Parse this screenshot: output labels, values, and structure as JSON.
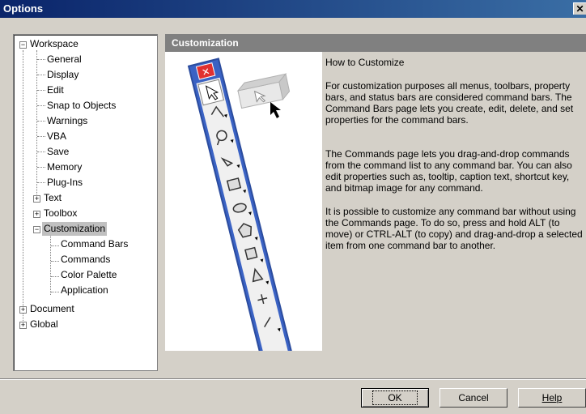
{
  "window": {
    "title": "Options",
    "close_glyph": "✕"
  },
  "tree": {
    "items": [
      {
        "label": "Workspace",
        "expander": "−"
      },
      {
        "label": "General"
      },
      {
        "label": "Display"
      },
      {
        "label": "Edit"
      },
      {
        "label": "Snap to Objects"
      },
      {
        "label": "Warnings"
      },
      {
        "label": "VBA"
      },
      {
        "label": "Save"
      },
      {
        "label": "Memory"
      },
      {
        "label": "Plug-Ins"
      },
      {
        "label": "Text",
        "expander": "+"
      },
      {
        "label": "Toolbox",
        "expander": "+"
      },
      {
        "label": "Customization",
        "expander": "−"
      },
      {
        "label": "Command Bars"
      },
      {
        "label": "Commands"
      },
      {
        "label": "Color Palette"
      },
      {
        "label": "Application"
      },
      {
        "label": "Document",
        "expander": "+"
      },
      {
        "label": "Global",
        "expander": "+"
      }
    ]
  },
  "panel": {
    "header": "Customization",
    "heading": "How to Customize",
    "paragraphs": [
      "For customization purposes all menus, toolbars, property bars, and status bars are considered command bars. The Command Bars page lets you create, edit, delete, and set properties for the command bars.",
      "The Commands page lets you drag-and-drop commands from the command list to any command bar. You can also edit properties such as, tooltip, caption text, shortcut key, and bitmap image for any command.",
      "It is possible to customize any command bar without using the Commands page. To do so, press and hold ALT (to move) or CTRL-ALT (to copy) and drag-and-drop a selected item from one command bar to another."
    ]
  },
  "buttons": {
    "ok": "OK",
    "cancel": "Cancel",
    "help": "Help"
  },
  "colors": {
    "titlebar": "#0a246a",
    "toolbar_blue": "#2b4c9e",
    "selection": "#c0c0c0"
  }
}
